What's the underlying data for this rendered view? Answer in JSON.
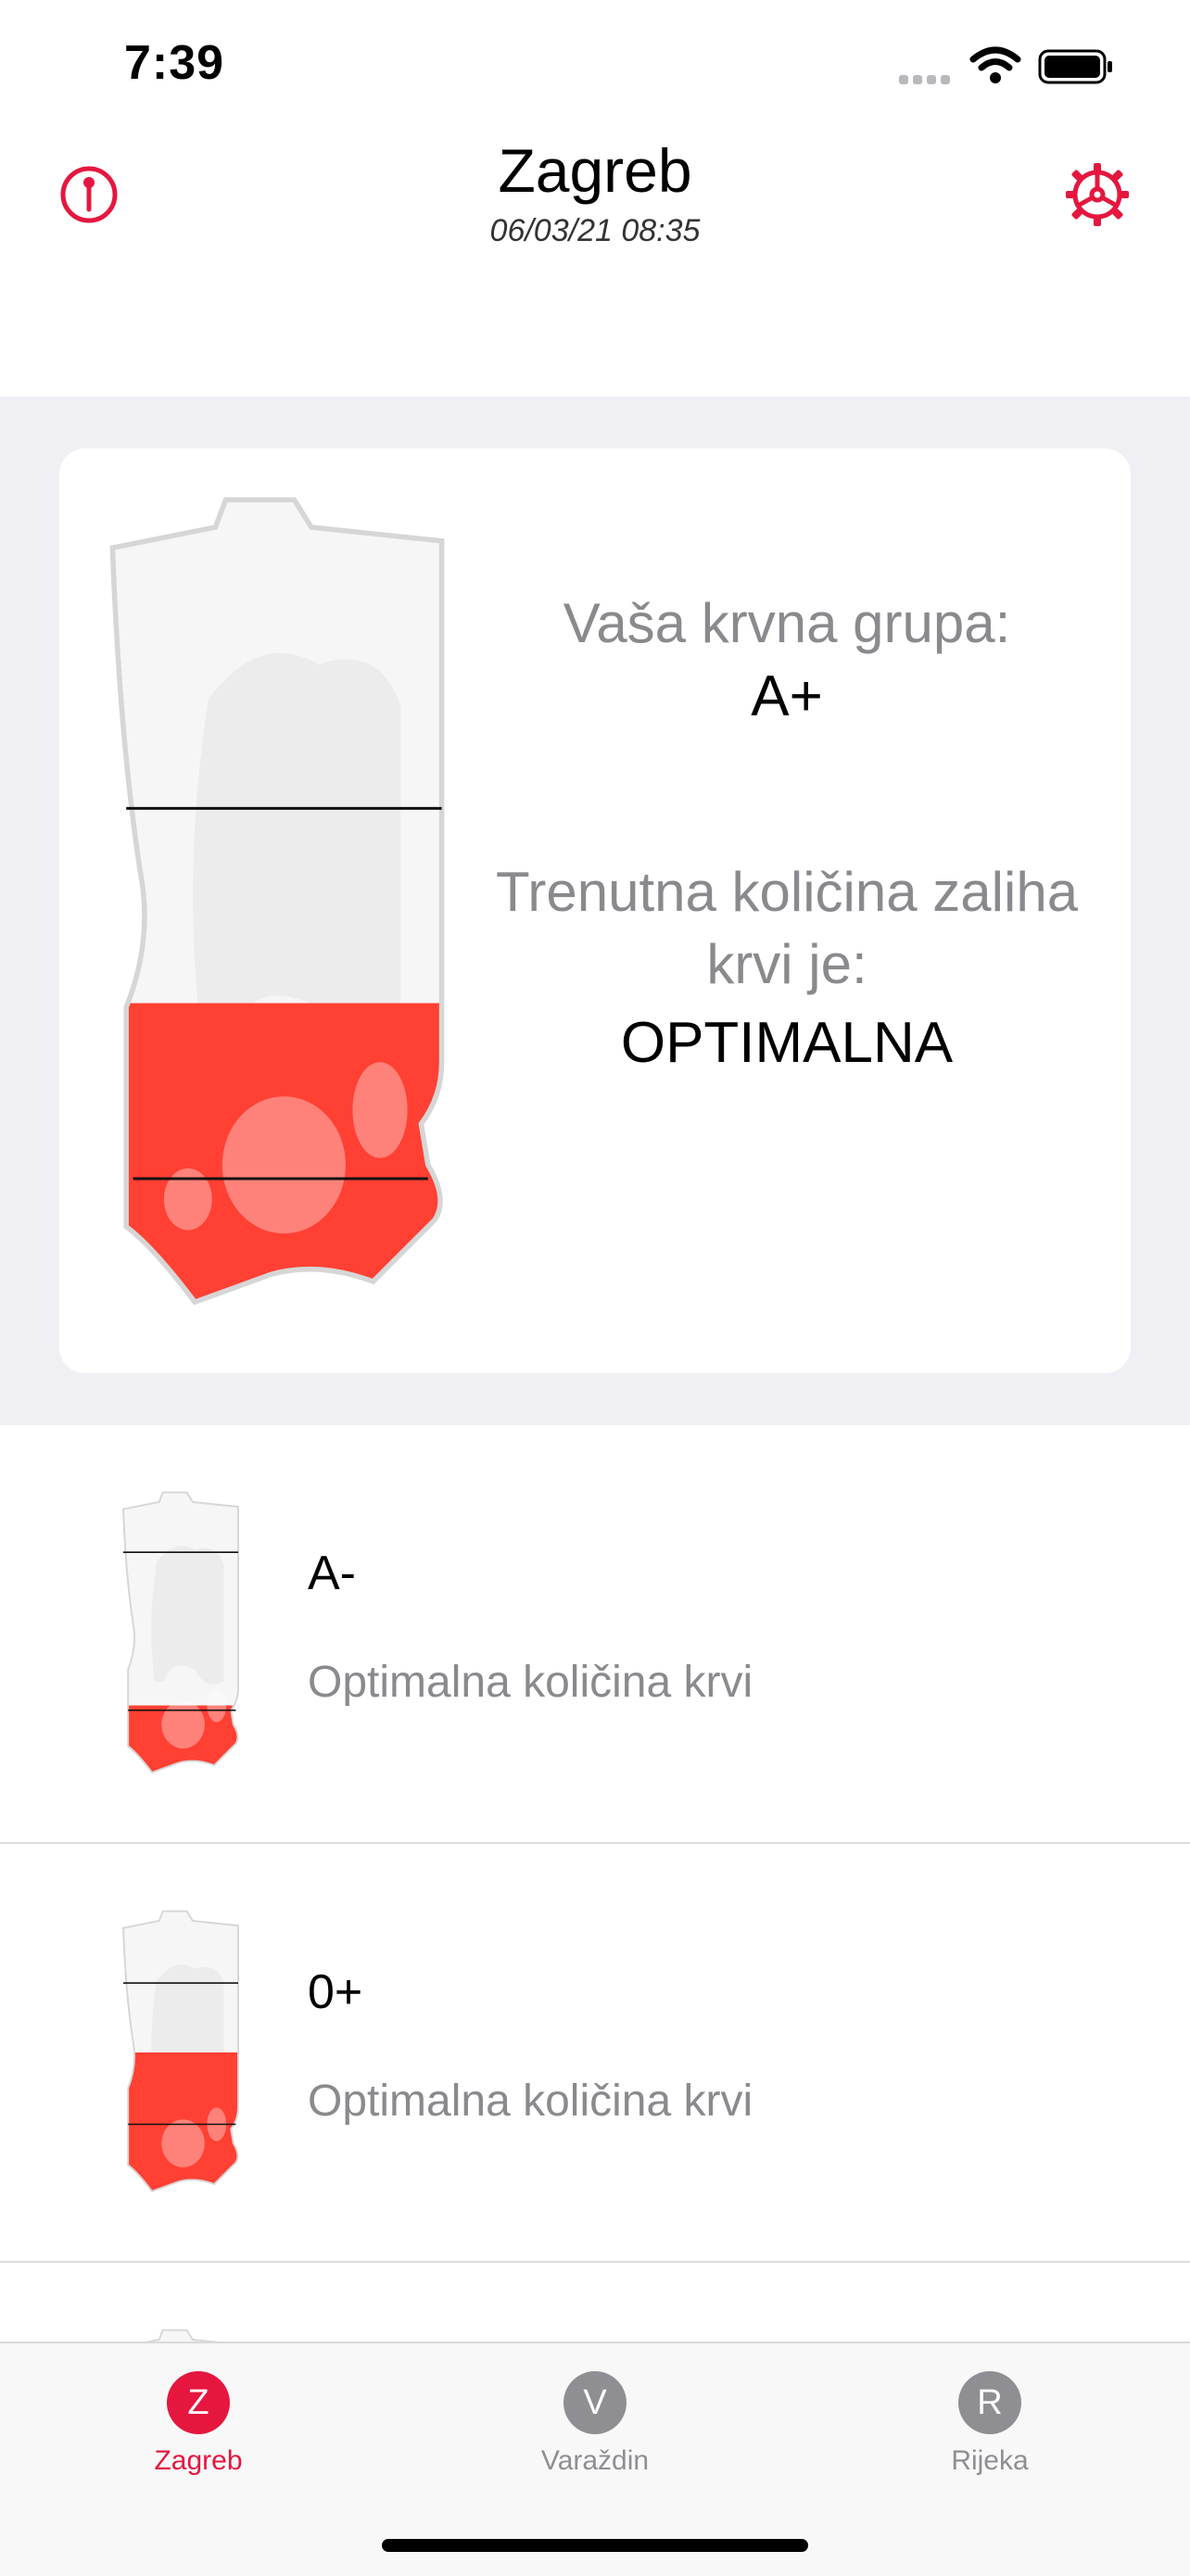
{
  "status": {
    "time": "7:39"
  },
  "header": {
    "title": "Zagreb",
    "datetime": "06/03/21 08:35"
  },
  "card": {
    "group_label": "Vaša krvna grupa:",
    "group_value": "A+",
    "stock_label_line1": "Trenutna količina zaliha",
    "stock_label_line2": "krvi je:",
    "stock_value": "OPTIMALNA",
    "fill_level": 0.38
  },
  "list": [
    {
      "group": "A-",
      "status": "Optimalna količina krvi",
      "fill_level": 0.25
    },
    {
      "group": "0+",
      "status": "Optimalna količina krvi",
      "fill_level": 0.5
    }
  ],
  "tabs": [
    {
      "letter": "Z",
      "label": "Zagreb",
      "active": true
    },
    {
      "letter": "V",
      "label": "Varaždin",
      "active": false
    },
    {
      "letter": "R",
      "label": "Rijeka",
      "active": false
    }
  ],
  "colors": {
    "accent": "#e5173f",
    "blood": "#ff4033",
    "inactive": "#8e8e93"
  }
}
